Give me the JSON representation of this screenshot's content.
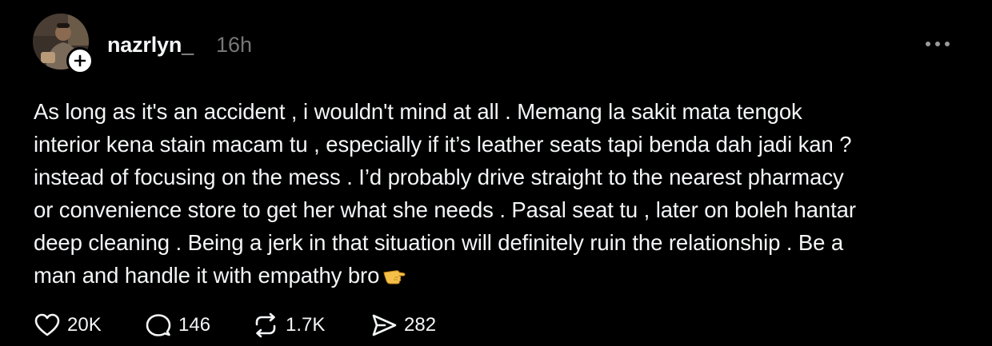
{
  "post": {
    "username": "nazrlyn_",
    "time": "16h",
    "lines": [
      "As long as it's an accident , i wouldn't mind at all . Memang la sakit mata tengok",
      "interior kena stain macam tu , especially if it’s leather seats tapi benda dah jadi kan ?",
      "instead of focusing on the mess . I’d probably drive straight to the nearest pharmacy",
      "or convenience store to get her what she needs . Pasal seat tu , later on boleh hantar",
      "deep cleaning . Being a jerk in that situation will definitely ruin the relationship . Be a",
      "man and handle it with empathy bro"
    ],
    "emoji": "pointing-hand-emoji"
  },
  "actions": {
    "likes": "20K",
    "replies": "146",
    "reposts": "1.7K",
    "shares": "282"
  },
  "colors": {
    "background": "#000000",
    "text": "#f3f5f7",
    "muted": "#777777"
  },
  "icons": {
    "avatar": "avatar",
    "follow": "plus-icon",
    "more": "more-dots-icon",
    "like": "heart-icon",
    "reply": "comment-icon",
    "repost": "repost-icon",
    "share": "send-icon"
  }
}
